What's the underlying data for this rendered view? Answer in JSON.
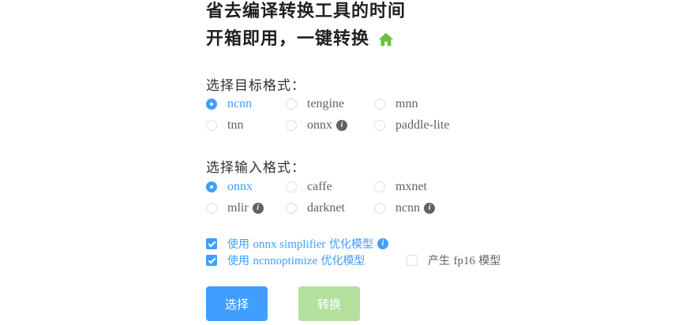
{
  "header": {
    "title_line1": "省去编译转换工具的时间",
    "title_line2": "开箱即用，一键转换"
  },
  "target": {
    "label": "选择目标格式：",
    "options": [
      "ncnn",
      "tengine",
      "mnn",
      "tnn",
      "onnx",
      "paddle-lite"
    ],
    "selected": "ncnn"
  },
  "input": {
    "label": "选择输入格式：",
    "options": [
      "onnx",
      "caffe",
      "mxnet",
      "mlir",
      "darknet",
      "ncnn"
    ],
    "selected": "onnx"
  },
  "options": {
    "simplifier": {
      "prefix": "使用 ",
      "name": "onnx simplifier",
      "suffix": " 优化模型",
      "checked": true
    },
    "ncnnoptimize": {
      "prefix": "使用 ",
      "name": "ncnnoptimize",
      "suffix": " 优化模型",
      "checked": true
    },
    "fp16": {
      "prefix": "产生 ",
      "name": "fp16",
      "suffix": " 模型",
      "checked": false
    }
  },
  "buttons": {
    "select_label": "选择",
    "convert_label": "转换"
  },
  "colors": {
    "primary": "#409eff",
    "success_disabled": "#b3e19d",
    "home_icon": "#67c23a"
  },
  "icons": {
    "home": "home-icon",
    "info": "info-icon"
  }
}
